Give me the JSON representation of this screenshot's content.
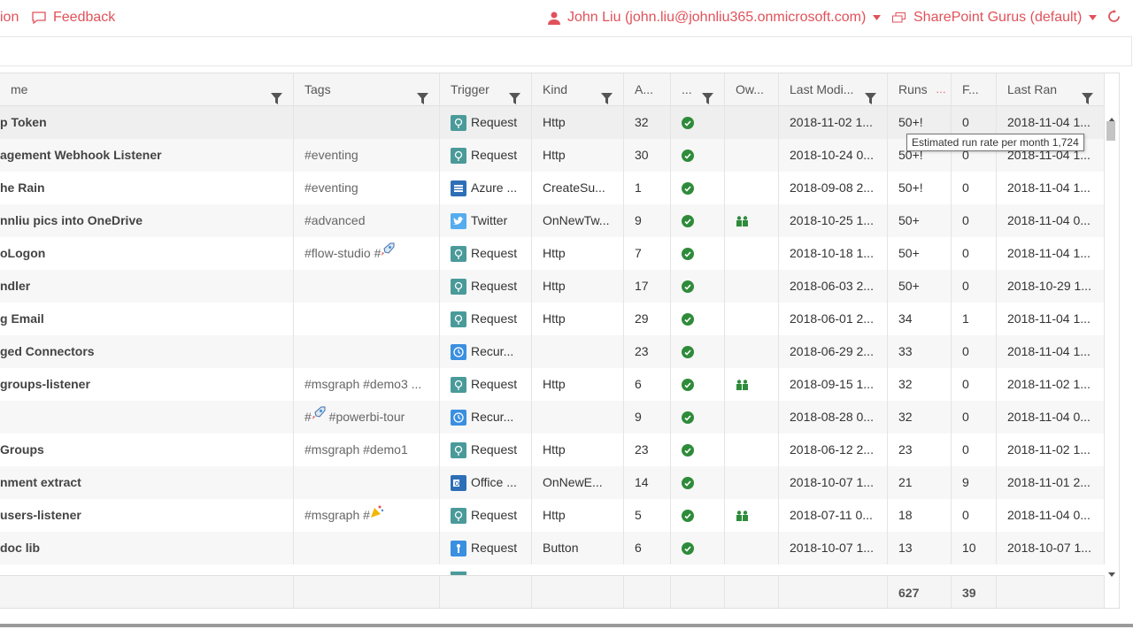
{
  "topbar": {
    "left_partial": "ion",
    "feedback": "Feedback",
    "user": "John Liu (john.liu@johnliu365.onmicrosoft.com)",
    "environment": "SharePoint Gurus (default)"
  },
  "columns": {
    "name": "me",
    "tags": "Tags",
    "trigger": "Trigger",
    "kind": "Kind",
    "actions": "A...",
    "status": "...",
    "owner": "Ow...",
    "last_modified": "Last Modi...",
    "runs": "Runs",
    "failures": "F...",
    "last_ran": "Last Ran"
  },
  "rows": [
    {
      "name": "p Token",
      "tags": "",
      "trigger": "Request",
      "trigger_icon": "request",
      "kind": "Http",
      "actions": "32",
      "owner": false,
      "modified": "2018-11-02 1...",
      "runs": "50+!",
      "fail": "0",
      "ran": "2018-11-04 1..."
    },
    {
      "name": "agement Webhook Listener",
      "tags": "#eventing",
      "trigger": "Request",
      "trigger_icon": "request",
      "kind": "Http",
      "actions": "30",
      "owner": false,
      "modified": "2018-10-24 0...",
      "runs": "50+!",
      "fail": "0",
      "ran": "2018-11-04 1..."
    },
    {
      "name": "he Rain",
      "tags": "#eventing",
      "trigger": "Azure ...",
      "trigger_icon": "azure",
      "kind": "CreateSu...",
      "actions": "1",
      "owner": false,
      "modified": "2018-09-08 2...",
      "runs": "50+!",
      "fail": "0",
      "ran": "2018-11-04 1..."
    },
    {
      "name": "nnliu pics into OneDrive",
      "tags": "#advanced",
      "trigger": "Twitter",
      "trigger_icon": "twitter",
      "kind": "OnNewTw...",
      "actions": "9",
      "owner": true,
      "modified": "2018-10-25 1...",
      "runs": "50+",
      "fail": "0",
      "ran": "2018-11-04 0..."
    },
    {
      "name": "oLogon",
      "tags": "#flow-studio #",
      "tag_emoji": "rocket",
      "trigger": "Request",
      "trigger_icon": "request",
      "kind": "Http",
      "actions": "7",
      "owner": false,
      "modified": "2018-10-18 1...",
      "runs": "50+",
      "fail": "0",
      "ran": "2018-11-04 1..."
    },
    {
      "name": "ndler",
      "tags": "",
      "trigger": "Request",
      "trigger_icon": "request",
      "kind": "Http",
      "actions": "17",
      "owner": false,
      "modified": "2018-06-03 2...",
      "runs": "50+",
      "fail": "0",
      "ran": "2018-10-29 1..."
    },
    {
      "name": "g Email",
      "tags": "",
      "trigger": "Request",
      "trigger_icon": "request",
      "kind": "Http",
      "actions": "29",
      "owner": false,
      "modified": "2018-06-01 2...",
      "runs": "34",
      "fail": "1",
      "ran": "2018-11-04 1..."
    },
    {
      "name": "ged Connectors",
      "tags": "",
      "trigger": "Recur...",
      "trigger_icon": "recurrence",
      "kind": "",
      "actions": "23",
      "owner": false,
      "modified": "2018-06-29 2...",
      "runs": "33",
      "fail": "0",
      "ran": "2018-11-04 1..."
    },
    {
      "name": "groups-listener",
      "tags": "#msgraph #demo3 ...",
      "trigger": "Request",
      "trigger_icon": "request",
      "kind": "Http",
      "actions": "6",
      "owner": true,
      "modified": "2018-09-15 1...",
      "runs": "32",
      "fail": "0",
      "ran": "2018-11-02 1..."
    },
    {
      "name": "",
      "tags_prefix": "#",
      "tag_emoji_mid": "rocket",
      "tags": "#powerbi-tour",
      "trigger": "Recur...",
      "trigger_icon": "recurrence",
      "kind": "",
      "actions": "9",
      "owner": false,
      "modified": "2018-08-28 0...",
      "runs": "32",
      "fail": "0",
      "ran": "2018-11-04 0..."
    },
    {
      "name": "Groups",
      "tags": "#msgraph #demo1",
      "trigger": "Request",
      "trigger_icon": "request",
      "kind": "Http",
      "actions": "23",
      "owner": false,
      "modified": "2018-06-12 2...",
      "runs": "23",
      "fail": "0",
      "ran": "2018-11-02 1..."
    },
    {
      "name": "nment extract",
      "tags": "",
      "trigger": "Office ...",
      "trigger_icon": "office",
      "kind": "OnNewE...",
      "actions": "14",
      "owner": false,
      "modified": "2018-10-07 1...",
      "runs": "21",
      "fail": "9",
      "ran": "2018-11-01 2..."
    },
    {
      "name": "users-listener",
      "tags": "#msgraph #",
      "tag_emoji": "party",
      "trigger": "Request",
      "trigger_icon": "request",
      "kind": "Http",
      "actions": "5",
      "owner": true,
      "modified": "2018-07-11 0...",
      "runs": "18",
      "fail": "0",
      "ran": "2018-11-04 0..."
    },
    {
      "name": "doc lib",
      "tags": "",
      "trigger": "Request",
      "trigger_icon": "button",
      "kind": "Button",
      "actions": "6",
      "owner": false,
      "modified": "2018-10-07 1...",
      "runs": "13",
      "fail": "10",
      "ran": "2018-10-07 1..."
    }
  ],
  "totals": {
    "runs": "627",
    "failures": "39"
  },
  "tooltip": "Estimated run rate per month 1,724",
  "colors": {
    "accent": "#e0525a",
    "success": "#2e8b3a",
    "request": "#4a9a9a",
    "azure": "#2d6fb7",
    "twitter": "#55acee",
    "recurrence": "#3b8fe0",
    "office": "#2d6fb7",
    "button": "#3b8fe0"
  }
}
